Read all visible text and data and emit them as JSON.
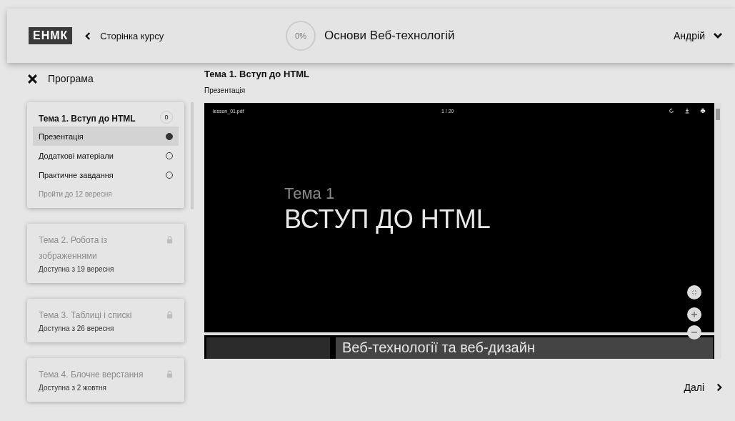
{
  "header": {
    "logo": "ЕНМК",
    "back_link": "Сторінка курсу",
    "progress": "0%",
    "course_title": "Основи Веб-технологій",
    "user": "Андрій"
  },
  "sidebar": {
    "title": "Програма",
    "topics": [
      {
        "title": "Тема 1. Вступ до HTML",
        "locked": false,
        "counter": "0",
        "lessons": [
          {
            "label": "Презентація",
            "selected": true
          },
          {
            "label": "Додаткові матеріали",
            "selected": false
          },
          {
            "label": "Практичне завдання",
            "selected": false
          }
        ],
        "note": "Пройти до 12 вересня"
      },
      {
        "title": "Тема 2. Робота із зображеннями",
        "locked": true,
        "note": "Доступна з 19 вересня"
      },
      {
        "title": "Тема 3. Таблиці і спискі",
        "locked": true,
        "note": "Доступна з 26 вересня"
      },
      {
        "title": "Тема 4. Блочне верстання",
        "locked": true,
        "note": "Доступна з 2 жовтня"
      }
    ]
  },
  "content": {
    "title": "Тема 1. Вступ до HTML",
    "subtitle": "Презентація",
    "viewer": {
      "file": "lesson_01.pdf",
      "pages": "1 / 20",
      "slide_kicker": "Тема 1",
      "slide_title": "ВСТУП ДО HTML",
      "next_slide_title": "Веб-технології та веб-дизайн"
    },
    "next": "Далі"
  }
}
